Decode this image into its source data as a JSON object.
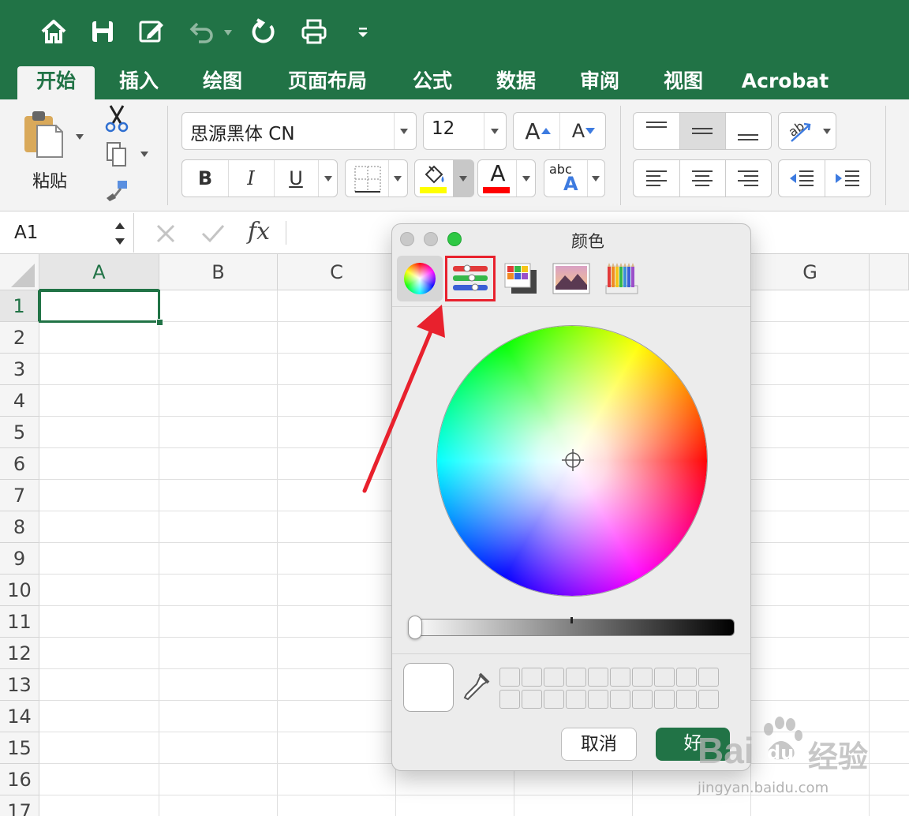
{
  "quick_access": {
    "icons": [
      "home-icon",
      "save-icon",
      "edit-icon",
      "undo-icon",
      "redo-icon",
      "print-icon",
      "customize-icon"
    ]
  },
  "tabs": [
    {
      "label": "开始",
      "active": true
    },
    {
      "label": "插入"
    },
    {
      "label": "绘图"
    },
    {
      "label": "页面布局"
    },
    {
      "label": "公式"
    },
    {
      "label": "数据"
    },
    {
      "label": "审阅"
    },
    {
      "label": "视图"
    },
    {
      "label": "Acrobat"
    }
  ],
  "ribbon": {
    "paste_label": "粘贴",
    "font_name": "思源黑体 CN",
    "font_size": "12",
    "bold": "B",
    "italic": "I",
    "underline": "U",
    "grow_font": "A",
    "shrink_font": "A",
    "font_color_letter": "A",
    "abc_label": "abc",
    "abc_letter": "A",
    "highlight_color": "#ffff00",
    "font_color": "#ff0000"
  },
  "formula_bar": {
    "cell_ref": "A1",
    "fx": "fx"
  },
  "grid": {
    "columns": [
      "A",
      "B",
      "C",
      "G"
    ],
    "rows": [
      "1",
      "2",
      "3",
      "4",
      "5",
      "6",
      "7",
      "8",
      "9",
      "10",
      "11",
      "12",
      "13",
      "14",
      "15",
      "16",
      "17"
    ],
    "selected_cell": "A1"
  },
  "dialog": {
    "title": "颜色",
    "modes": [
      "color-wheel-icon",
      "sliders-icon",
      "palettes-icon",
      "image-palettes-icon",
      "pencils-icon"
    ],
    "selected_mode_highlight": "sliders-icon",
    "cancel_label": "取消",
    "ok_label": "好",
    "accent_color": "#217346",
    "annotation_color": "#e8212d"
  },
  "watermark": {
    "brand": "Bai",
    "brand_suffix": "du",
    "brand_cn": "经验",
    "url": "jingyan.baidu.com"
  }
}
